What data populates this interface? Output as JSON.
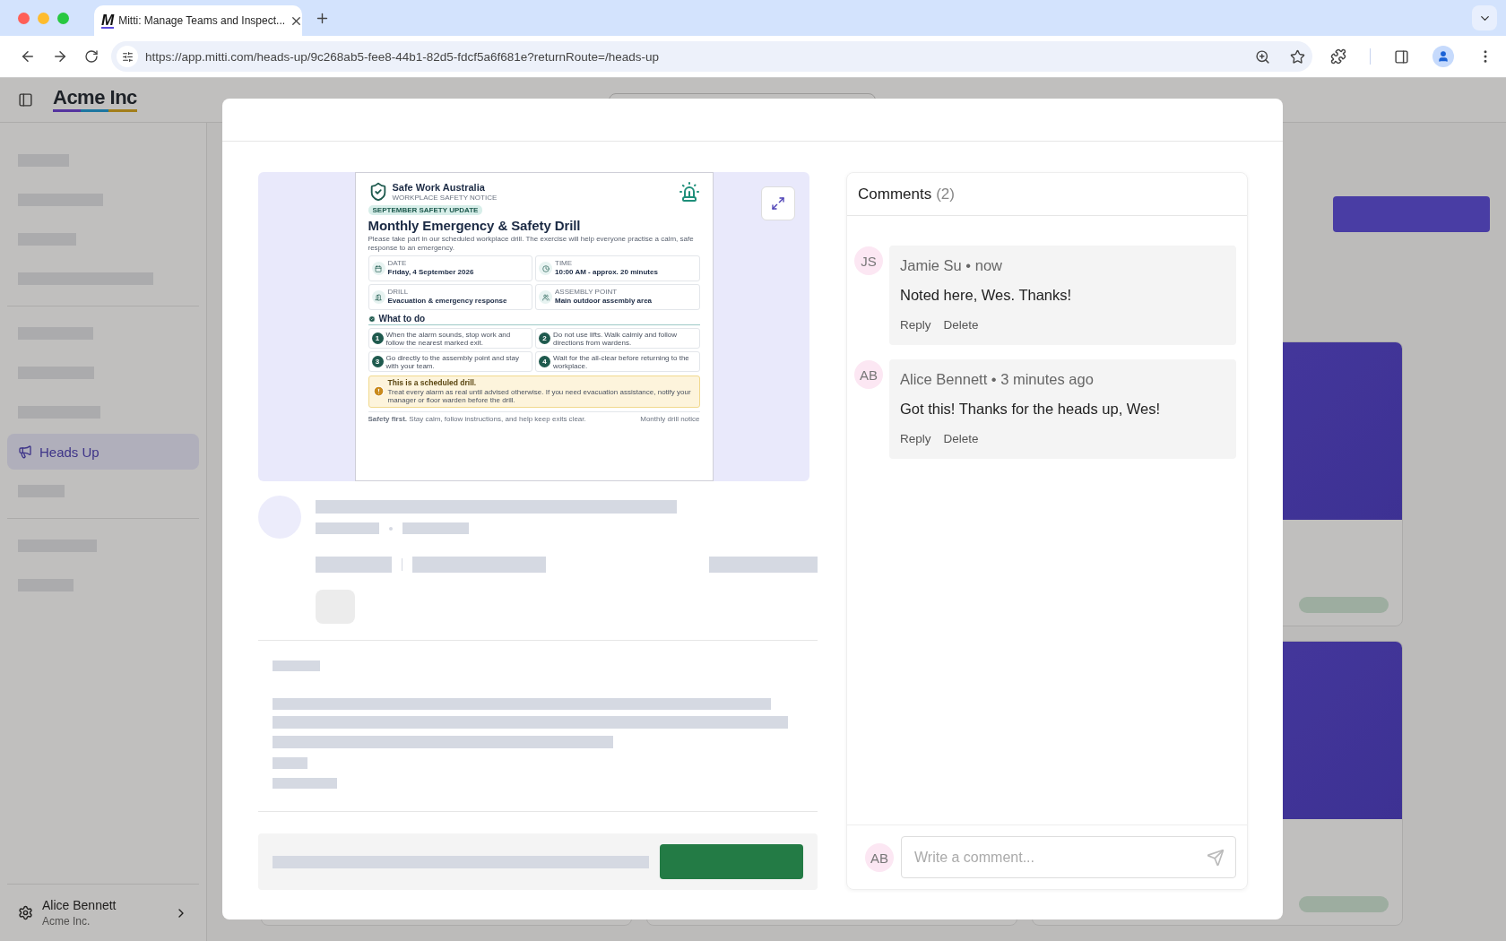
{
  "browser": {
    "tab": {
      "logo": "M",
      "title": "Mitti: Manage Teams and Inspect...",
      "selected": true
    },
    "url": "https://app.mitti.com/heads-up/9c268ab5-fee8-44b1-82d5-fdcf5a6f681e?returnRoute=/heads-up"
  },
  "app": {
    "brand": "Acme Inc",
    "sidebar": {
      "active_item": {
        "label": "Heads Up",
        "selected": true
      },
      "user": {
        "name": "Alice Bennett",
        "org": "Acme Inc."
      }
    }
  },
  "modal": {
    "poster": {
      "org": "Safe Work Australia",
      "subtitle": "WORKPLACE SAFETY NOTICE",
      "tag": "SEPTEMBER SAFETY UPDATE",
      "title": "Monthly Emergency & Safety Drill",
      "intro": "Please take part in our scheduled workplace drill. The exercise will help everyone practise a calm, safe response to an emergency.",
      "facts": [
        {
          "kind": "date",
          "label": "DATE",
          "value": "Friday, 4 September 2026"
        },
        {
          "kind": "time",
          "label": "TIME",
          "value": "10:00 AM - approx. 20 minutes"
        },
        {
          "kind": "drill",
          "label": "DRILL",
          "value": "Evacuation & emergency response"
        },
        {
          "kind": "assembly",
          "label": "ASSEMBLY POINT",
          "value": "Main outdoor assembly area"
        }
      ],
      "section_title": "What to do",
      "steps": [
        {
          "number": "1",
          "text": "When the alarm sounds, stop work and follow the nearest marked exit."
        },
        {
          "number": "2",
          "text": "Do not use lifts. Walk calmly and follow directions from wardens."
        },
        {
          "number": "3",
          "text": "Go directly to the assembly point and stay with your team."
        },
        {
          "number": "4",
          "text": "Wait for the all-clear before returning to the workplace."
        }
      ],
      "notice": {
        "title": "This is a scheduled drill.",
        "body": "Treat every alarm as real until advised otherwise. If you need evacuation assistance, notify your manager or floor warden before the drill."
      },
      "footer_note": "**Safety first.** Stay calm, follow instructions, and help keep exits clear.",
      "footer_right": "Monthly drill notice"
    },
    "comments": {
      "title": "Comments",
      "count": "(2)",
      "items": [
        {
          "initials": "JS",
          "meta": "Jamie Su • now",
          "body": "Noted here, Wes. Thanks!",
          "actions": [
            "Reply",
            "Delete"
          ]
        },
        {
          "initials": "AB",
          "meta": "Alice Bennett • 3 minutes ago",
          "body": "Got this! Thanks for the heads up, Wes!",
          "actions": [
            "Reply",
            "Delete"
          ]
        }
      ],
      "composer": {
        "initials": "AB",
        "placeholder": "Write a comment..."
      }
    }
  }
}
